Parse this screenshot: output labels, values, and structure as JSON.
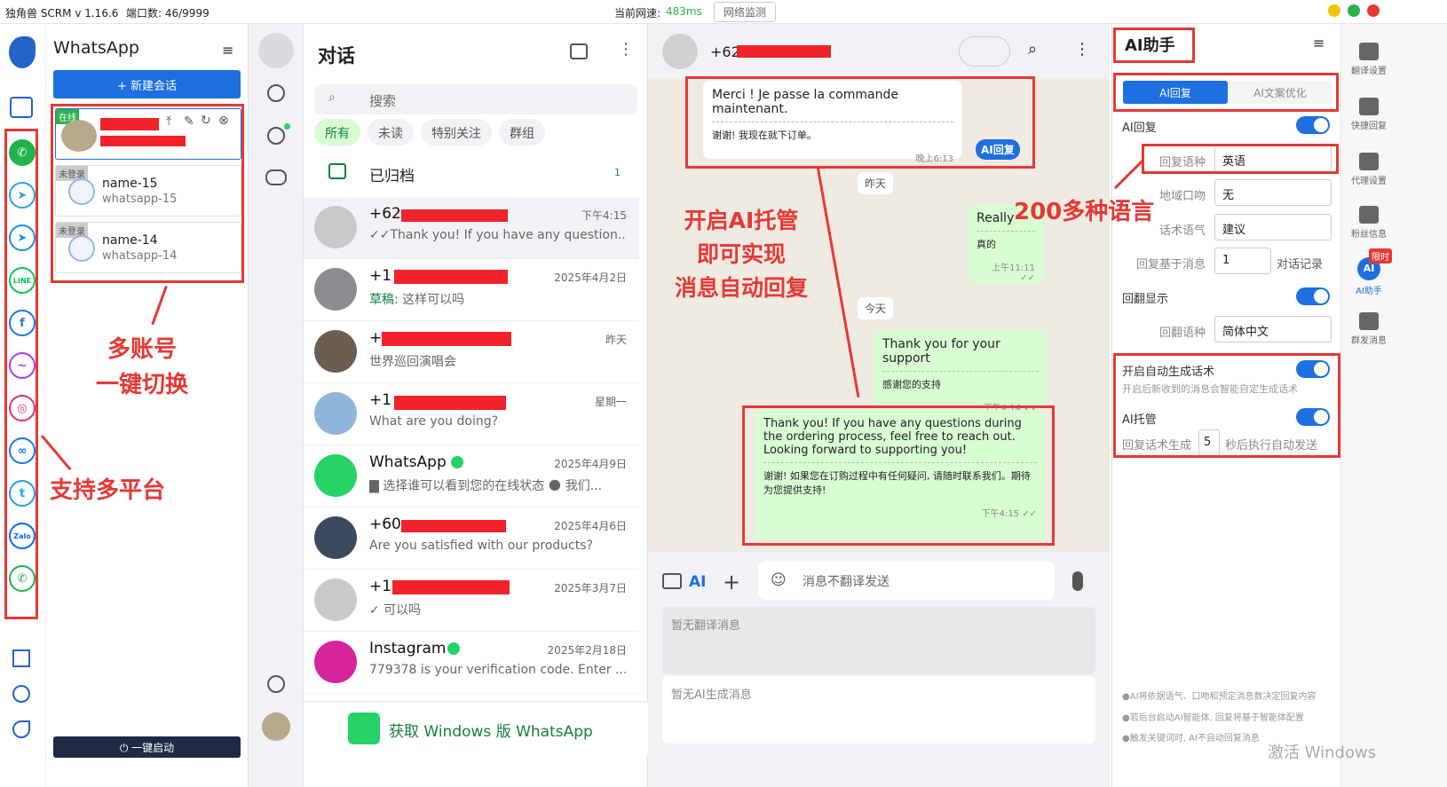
{
  "topbar": {
    "app_name": "独角兽 SCRM v 1.16.6",
    "ports": "端口数: 46/9999",
    "speed_label": "当前网速:",
    "speed_value": "483ms",
    "monitor_button": "网络监测"
  },
  "accounts": {
    "title": "WhatsApp",
    "new_chat": "+ 新建会话",
    "items": [
      {
        "tag": "在线",
        "name": "",
        "sub": ""
      },
      {
        "tag": "未登录",
        "name": "name-15",
        "sub": "whatsapp-15"
      },
      {
        "tag": "未登录",
        "name": "name-14",
        "sub": "whatsapp-14"
      }
    ],
    "start_button": "⏻ 一键启动"
  },
  "chatlist": {
    "title": "对话",
    "search_placeholder": "搜索",
    "filters": [
      "所有",
      "未读",
      "特别关注",
      "群组"
    ],
    "archived_label": "已归档",
    "archived_count": "1",
    "chats": [
      {
        "name": "+62",
        "time": "下午4:15",
        "preview": "✓✓Thank you! If you have any question..."
      },
      {
        "name": "+1",
        "time": "2025年4月2日",
        "preview_prefix": "草稿:",
        "preview": " 这样可以吗"
      },
      {
        "name": "+",
        "time": "昨天",
        "preview": "世界巡回演唱会"
      },
      {
        "name": "+1",
        "time": "星期一",
        "preview": "What are you doing?"
      },
      {
        "name": "WhatsApp",
        "time": "2025年4月9日",
        "preview": "▇ 选择谁可以看到您的在线状态 🌑 我们..."
      },
      {
        "name": "+60",
        "time": "2025年4月6日",
        "preview": "Are you satisfied with our products?"
      },
      {
        "name": "+1",
        "time": "2025年3月7日",
        "preview": "✓ 可以吗"
      },
      {
        "name": "Instagram",
        "time": "2025年2月18日",
        "preview": "779378 is your verification code. Enter ..."
      }
    ],
    "get_windows": "获取 Windows 版 WhatsApp"
  },
  "conversation": {
    "contact": "+62",
    "msg1": {
      "text": "Merci ! Je passe la commande maintenant.",
      "translation": "谢谢! 我现在就下订单。",
      "time": "晚上6:13",
      "ai_badge": "AI回复"
    },
    "date1": "昨天",
    "msg2": {
      "text": "Really",
      "translation": "真的",
      "time": "上午11:11 ✓✓"
    },
    "date2": "今天",
    "msg3": {
      "text": "Thank you for your support",
      "translation": "感谢您的支持",
      "time": "下午4:14 ✓✓"
    },
    "msg4": {
      "text": "Thank you! If you have any questions during the ordering process, feel free to reach out. Looking forward to supporting you!",
      "translation": "谢谢! 如果您在订购过程中有任何疑问, 请随时联系我们。期待为您提供支持!",
      "time": "下午4:15 ✓✓"
    },
    "ai_label": "AI",
    "input_placeholder": "消息不翻译发送",
    "no_translate": "暂无翻译消息",
    "no_ai": "暂无AI生成消息"
  },
  "ai_panel": {
    "title": "AI助手",
    "tabs": [
      "AI回复",
      "AI文案优化"
    ],
    "ai_reply": "AI回复",
    "reply_lang_label": "回复语种",
    "reply_lang": "英语",
    "region_label": "地域口吻",
    "region": "无",
    "tone_label": "话术语气",
    "tone": "建议",
    "based_label": "回复基于消息",
    "based_value": "1",
    "based_suffix": "对话记录",
    "translate_show": "回翻显示",
    "translate_lang_label": "回翻语种",
    "translate_lang": "简体中文",
    "auto_gen": "开启自动生成话术",
    "auto_gen_desc": "开启后新收到的消息会智能自定生成话术",
    "ai_host": "AI托管",
    "gen_label": "回复话术生成",
    "gen_value": "5",
    "gen_suffix": "秒后执行自动发送",
    "notes": [
      "●AI将依据语气、口吻和预定消息数决定回复内容",
      "●若后台启动AI智能体, 回复将基于智能体配置",
      "●触发关键词时, AI不自动回复消息"
    ]
  },
  "right_side": [
    "翻译设置",
    "快捷回复",
    "代理设置",
    "粉丝信息",
    "AI助手",
    "群发消息"
  ],
  "limited_badge": "限时",
  "watermark": "激活 Windows",
  "annotations": {
    "multi_account": "多账号\n一键切换",
    "multi_platform": "支持多平台",
    "ai_host": "开启AI托管\n即可实现\n消息自动回复",
    "languages": "200多种语言"
  }
}
